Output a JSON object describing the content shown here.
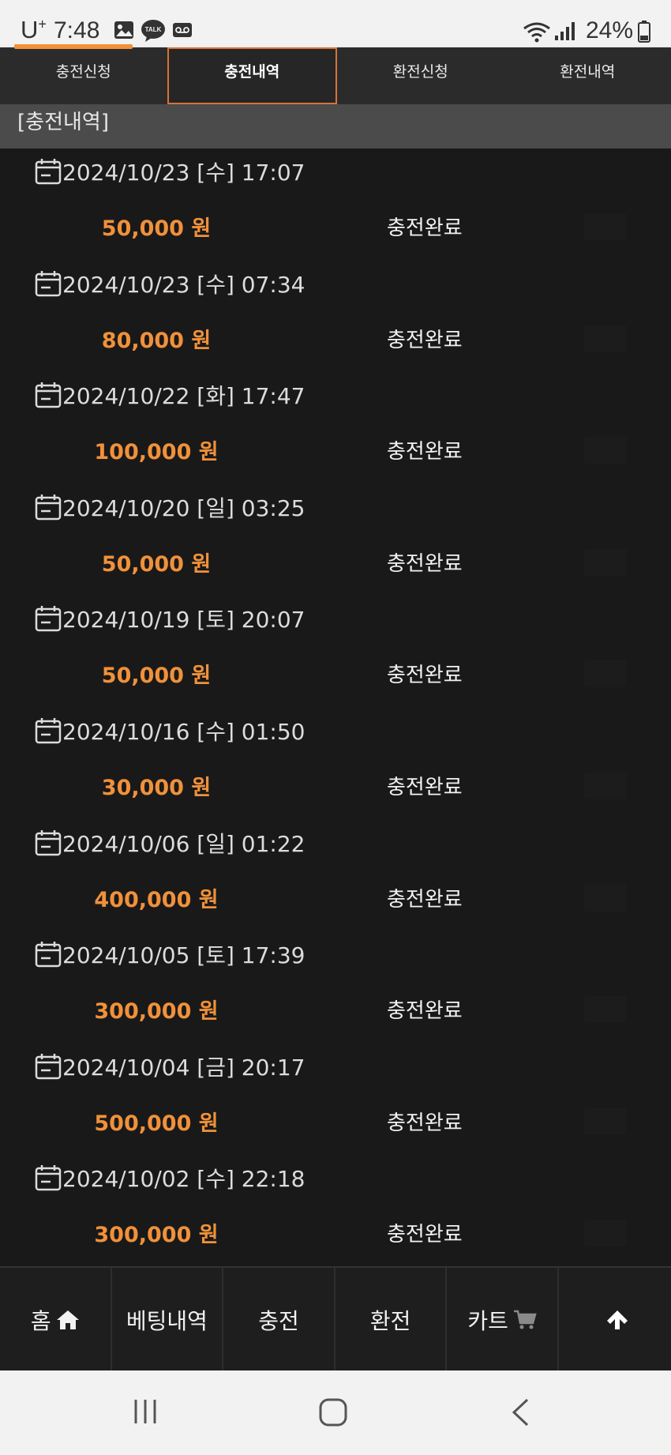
{
  "status_bar": {
    "carrier": "U",
    "carrier_sup": "+",
    "time": "7:48",
    "talk_label": "TALK",
    "battery": "24%"
  },
  "tabs": [
    {
      "label": "충전신청",
      "active": false
    },
    {
      "label": "충전내역",
      "active": true
    },
    {
      "label": "환전신청",
      "active": false
    },
    {
      "label": "환전내역",
      "active": false
    }
  ],
  "section_title": "[충전내역]",
  "entries": [
    {
      "datetime": "2024/10/23 [수] 17:07",
      "amount": "50,000 원",
      "status": "충전완료"
    },
    {
      "datetime": "2024/10/23 [수] 07:34",
      "amount": "80,000 원",
      "status": "충전완료"
    },
    {
      "datetime": "2024/10/22 [화] 17:47",
      "amount": "100,000 원",
      "status": "충전완료"
    },
    {
      "datetime": "2024/10/20 [일] 03:25",
      "amount": "50,000 원",
      "status": "충전완료"
    },
    {
      "datetime": "2024/10/19 [토] 20:07",
      "amount": "50,000 원",
      "status": "충전완료"
    },
    {
      "datetime": "2024/10/16 [수] 01:50",
      "amount": "30,000 원",
      "status": "충전완료"
    },
    {
      "datetime": "2024/10/06 [일] 01:22",
      "amount": "400,000 원",
      "status": "충전완료"
    },
    {
      "datetime": "2024/10/05 [토] 17:39",
      "amount": "300,000 원",
      "status": "충전완료"
    },
    {
      "datetime": "2024/10/04 [금] 20:17",
      "amount": "500,000 원",
      "status": "충전완료"
    },
    {
      "datetime": "2024/10/02 [수] 22:18",
      "amount": "300,000 원",
      "status": "충전완료"
    }
  ],
  "bottom_nav": {
    "home": "홈",
    "bets": "베팅내역",
    "charge": "충전",
    "exchange": "환전",
    "cart": "카트"
  },
  "colors": {
    "accent": "#f0913a",
    "background": "#1a1919",
    "tab_active_border": "#d4733a"
  },
  "icons": {
    "home": "home-icon",
    "cart": "cart-icon",
    "up": "arrow-up-icon",
    "calendar": "calendar-icon"
  }
}
